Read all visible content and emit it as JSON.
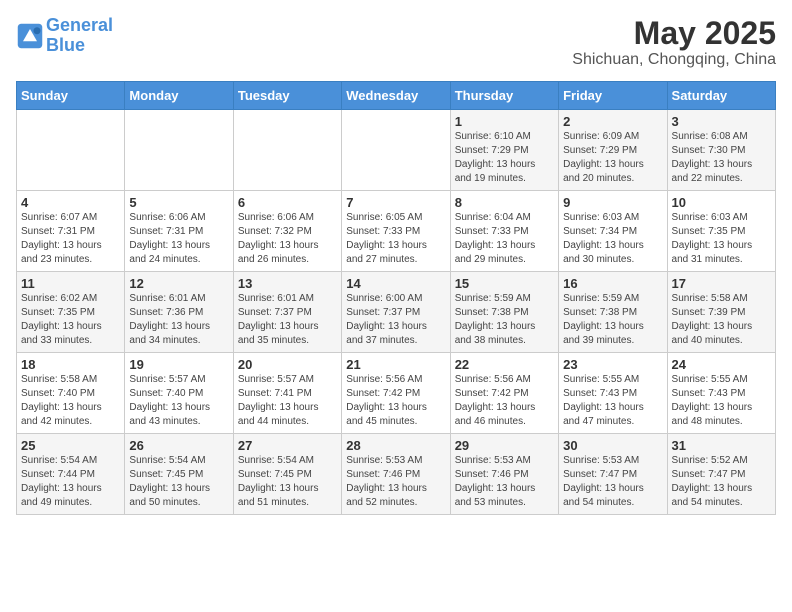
{
  "header": {
    "logo_line1": "General",
    "logo_line2": "Blue",
    "title": "May 2025",
    "subtitle": "Shichuan, Chongqing, China"
  },
  "days_of_week": [
    "Sunday",
    "Monday",
    "Tuesday",
    "Wednesday",
    "Thursday",
    "Friday",
    "Saturday"
  ],
  "weeks": [
    [
      {
        "day": "",
        "info": ""
      },
      {
        "day": "",
        "info": ""
      },
      {
        "day": "",
        "info": ""
      },
      {
        "day": "",
        "info": ""
      },
      {
        "day": "1",
        "info": "Sunrise: 6:10 AM\nSunset: 7:29 PM\nDaylight: 13 hours\nand 19 minutes."
      },
      {
        "day": "2",
        "info": "Sunrise: 6:09 AM\nSunset: 7:29 PM\nDaylight: 13 hours\nand 20 minutes."
      },
      {
        "day": "3",
        "info": "Sunrise: 6:08 AM\nSunset: 7:30 PM\nDaylight: 13 hours\nand 22 minutes."
      }
    ],
    [
      {
        "day": "4",
        "info": "Sunrise: 6:07 AM\nSunset: 7:31 PM\nDaylight: 13 hours\nand 23 minutes."
      },
      {
        "day": "5",
        "info": "Sunrise: 6:06 AM\nSunset: 7:31 PM\nDaylight: 13 hours\nand 24 minutes."
      },
      {
        "day": "6",
        "info": "Sunrise: 6:06 AM\nSunset: 7:32 PM\nDaylight: 13 hours\nand 26 minutes."
      },
      {
        "day": "7",
        "info": "Sunrise: 6:05 AM\nSunset: 7:33 PM\nDaylight: 13 hours\nand 27 minutes."
      },
      {
        "day": "8",
        "info": "Sunrise: 6:04 AM\nSunset: 7:33 PM\nDaylight: 13 hours\nand 29 minutes."
      },
      {
        "day": "9",
        "info": "Sunrise: 6:03 AM\nSunset: 7:34 PM\nDaylight: 13 hours\nand 30 minutes."
      },
      {
        "day": "10",
        "info": "Sunrise: 6:03 AM\nSunset: 7:35 PM\nDaylight: 13 hours\nand 31 minutes."
      }
    ],
    [
      {
        "day": "11",
        "info": "Sunrise: 6:02 AM\nSunset: 7:35 PM\nDaylight: 13 hours\nand 33 minutes."
      },
      {
        "day": "12",
        "info": "Sunrise: 6:01 AM\nSunset: 7:36 PM\nDaylight: 13 hours\nand 34 minutes."
      },
      {
        "day": "13",
        "info": "Sunrise: 6:01 AM\nSunset: 7:37 PM\nDaylight: 13 hours\nand 35 minutes."
      },
      {
        "day": "14",
        "info": "Sunrise: 6:00 AM\nSunset: 7:37 PM\nDaylight: 13 hours\nand 37 minutes."
      },
      {
        "day": "15",
        "info": "Sunrise: 5:59 AM\nSunset: 7:38 PM\nDaylight: 13 hours\nand 38 minutes."
      },
      {
        "day": "16",
        "info": "Sunrise: 5:59 AM\nSunset: 7:38 PM\nDaylight: 13 hours\nand 39 minutes."
      },
      {
        "day": "17",
        "info": "Sunrise: 5:58 AM\nSunset: 7:39 PM\nDaylight: 13 hours\nand 40 minutes."
      }
    ],
    [
      {
        "day": "18",
        "info": "Sunrise: 5:58 AM\nSunset: 7:40 PM\nDaylight: 13 hours\nand 42 minutes."
      },
      {
        "day": "19",
        "info": "Sunrise: 5:57 AM\nSunset: 7:40 PM\nDaylight: 13 hours\nand 43 minutes."
      },
      {
        "day": "20",
        "info": "Sunrise: 5:57 AM\nSunset: 7:41 PM\nDaylight: 13 hours\nand 44 minutes."
      },
      {
        "day": "21",
        "info": "Sunrise: 5:56 AM\nSunset: 7:42 PM\nDaylight: 13 hours\nand 45 minutes."
      },
      {
        "day": "22",
        "info": "Sunrise: 5:56 AM\nSunset: 7:42 PM\nDaylight: 13 hours\nand 46 minutes."
      },
      {
        "day": "23",
        "info": "Sunrise: 5:55 AM\nSunset: 7:43 PM\nDaylight: 13 hours\nand 47 minutes."
      },
      {
        "day": "24",
        "info": "Sunrise: 5:55 AM\nSunset: 7:43 PM\nDaylight: 13 hours\nand 48 minutes."
      }
    ],
    [
      {
        "day": "25",
        "info": "Sunrise: 5:54 AM\nSunset: 7:44 PM\nDaylight: 13 hours\nand 49 minutes."
      },
      {
        "day": "26",
        "info": "Sunrise: 5:54 AM\nSunset: 7:45 PM\nDaylight: 13 hours\nand 50 minutes."
      },
      {
        "day": "27",
        "info": "Sunrise: 5:54 AM\nSunset: 7:45 PM\nDaylight: 13 hours\nand 51 minutes."
      },
      {
        "day": "28",
        "info": "Sunrise: 5:53 AM\nSunset: 7:46 PM\nDaylight: 13 hours\nand 52 minutes."
      },
      {
        "day": "29",
        "info": "Sunrise: 5:53 AM\nSunset: 7:46 PM\nDaylight: 13 hours\nand 53 minutes."
      },
      {
        "day": "30",
        "info": "Sunrise: 5:53 AM\nSunset: 7:47 PM\nDaylight: 13 hours\nand 54 minutes."
      },
      {
        "day": "31",
        "info": "Sunrise: 5:52 AM\nSunset: 7:47 PM\nDaylight: 13 hours\nand 54 minutes."
      }
    ]
  ]
}
